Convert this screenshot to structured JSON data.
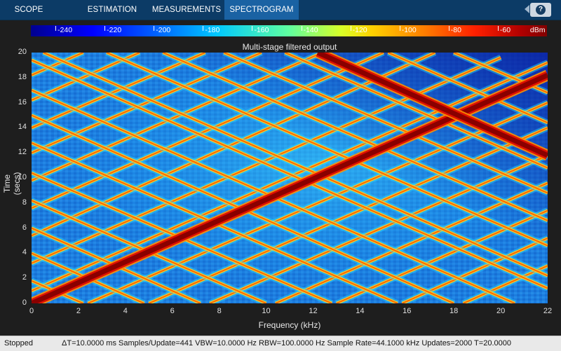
{
  "toolstrip": {
    "tabs": [
      {
        "label": "SCOPE",
        "active": false
      },
      {
        "label": "ESTIMATION",
        "active": false
      },
      {
        "label": "MEASUREMENTS",
        "active": false
      },
      {
        "label": "SPECTROGRAM",
        "active": true
      }
    ],
    "help_label": "?"
  },
  "colorbar": {
    "ticks": [
      "-240",
      "-220",
      "-200",
      "-180",
      "-160",
      "-140",
      "-120",
      "-100",
      "-80",
      "-60"
    ],
    "units": "dBm",
    "range": [
      -250,
      -40
    ]
  },
  "plot": {
    "title": "Multi-stage filtered output",
    "xlabel": "Frequency (kHz)",
    "ylabel": "Time (secs)",
    "xticks": [
      "0",
      "2",
      "4",
      "6",
      "8",
      "10",
      "12",
      "14",
      "16",
      "18",
      "20",
      "22"
    ],
    "yticks": [
      "0",
      "2",
      "4",
      "6",
      "8",
      "10",
      "12",
      "14",
      "16",
      "18",
      "20"
    ]
  },
  "chart_data": {
    "type": "heatmap",
    "title": "Multi-stage filtered output",
    "xlabel": "Frequency (kHz)",
    "ylabel": "Time (secs)",
    "xlim": [
      0,
      22
    ],
    "ylim": [
      0,
      20
    ],
    "colorbar_units": "dBm",
    "background_level_dbm": -170,
    "main_chirp_line": {
      "points": [
        [
          0,
          0
        ],
        [
          22,
          18.2
        ]
      ],
      "level_dbm": -50
    },
    "reflected_chirp_line": {
      "points": [
        [
          12.2,
          20
        ],
        [
          22,
          11.8
        ]
      ],
      "level_dbm": -50
    },
    "aliased_lines": [
      {
        "points": [
          [
            0,
            1.0
          ],
          [
            22,
            19.2
          ]
        ]
      },
      {
        "points": [
          [
            0,
            3.2
          ],
          [
            20,
            19.6
          ]
        ]
      },
      {
        "points": [
          [
            0,
            5.4
          ],
          [
            17.2,
            20
          ]
        ]
      },
      {
        "points": [
          [
            0,
            7.6
          ],
          [
            15,
            20
          ]
        ]
      },
      {
        "points": [
          [
            0,
            9.8
          ],
          [
            12.4,
            20
          ]
        ]
      },
      {
        "points": [
          [
            0,
            12.0
          ],
          [
            9.8,
            20
          ]
        ]
      },
      {
        "points": [
          [
            0,
            14.0
          ],
          [
            7.4,
            20
          ]
        ]
      },
      {
        "points": [
          [
            0,
            16.2
          ],
          [
            4.6,
            20
          ]
        ]
      },
      {
        "points": [
          [
            0,
            18.2
          ],
          [
            2.2,
            20
          ]
        ]
      },
      {
        "points": [
          [
            2.4,
            0
          ],
          [
            22,
            16.0
          ]
        ]
      },
      {
        "points": [
          [
            5.0,
            0
          ],
          [
            22,
            14.0
          ]
        ]
      },
      {
        "points": [
          [
            7.6,
            0
          ],
          [
            22,
            11.8
          ]
        ]
      },
      {
        "points": [
          [
            10.4,
            0
          ],
          [
            22,
            9.6
          ]
        ]
      },
      {
        "points": [
          [
            13.0,
            0
          ],
          [
            22,
            7.4
          ]
        ]
      },
      {
        "points": [
          [
            15.8,
            0
          ],
          [
            22,
            5.2
          ]
        ]
      },
      {
        "points": [
          [
            18.4,
            0
          ],
          [
            22,
            3.0
          ]
        ]
      },
      {
        "points": [
          [
            0.5,
            20
          ],
          [
            22,
            2.2
          ]
        ]
      },
      {
        "points": [
          [
            0,
            19.4
          ],
          [
            22,
            1.2
          ]
        ]
      },
      {
        "points": [
          [
            0,
            17.0
          ],
          [
            20.6,
            0
          ]
        ]
      },
      {
        "points": [
          [
            0,
            15.0
          ],
          [
            18.0,
            0
          ]
        ]
      },
      {
        "points": [
          [
            0,
            12.8
          ],
          [
            15.6,
            0
          ]
        ]
      },
      {
        "points": [
          [
            0,
            10.4
          ],
          [
            12.8,
            0
          ]
        ]
      },
      {
        "points": [
          [
            0,
            8.2
          ],
          [
            10.0,
            0
          ]
        ]
      },
      {
        "points": [
          [
            0,
            6.0
          ],
          [
            7.2,
            0
          ]
        ]
      },
      {
        "points": [
          [
            0,
            4.0
          ],
          [
            4.8,
            0
          ]
        ]
      },
      {
        "points": [
          [
            0,
            1.8
          ],
          [
            2.2,
            0
          ]
        ]
      },
      {
        "points": [
          [
            3.2,
            20
          ],
          [
            22,
            4.6
          ]
        ]
      },
      {
        "points": [
          [
            5.6,
            20
          ],
          [
            22,
            6.6
          ]
        ]
      },
      {
        "points": [
          [
            8.2,
            20
          ],
          [
            22,
            8.8
          ]
        ]
      },
      {
        "points": [
          [
            10.8,
            20
          ],
          [
            22,
            10.8
          ]
        ]
      },
      {
        "points": [
          [
            15.2,
            20
          ],
          [
            22,
            14.4
          ]
        ]
      },
      {
        "points": [
          [
            18.0,
            20
          ],
          [
            22,
            16.8
          ]
        ]
      }
    ]
  },
  "status": {
    "state": "Stopped",
    "details": "ΔT=10.0000 ms  Samples/Update=441  VBW=10.0000 Hz  RBW=100.0000 Hz  Sample Rate=44.1000 kHz  Updates=2000  T=20.0000"
  }
}
